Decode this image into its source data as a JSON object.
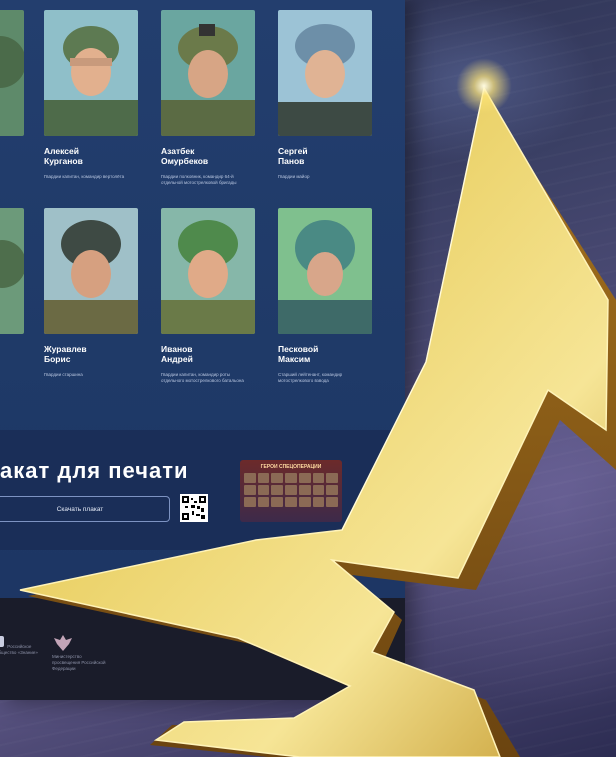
{
  "cards": [
    {
      "name": "Алексей\nКурганов",
      "desc": "Гвардии капитан, командир вертолёта"
    },
    {
      "name": "Азатбек\nОмурбеков",
      "desc": "Гвардии полковник, командир 64-й отдельной мотострелковой бригады"
    },
    {
      "name": "Сергей\nПанов",
      "desc": "Гвардии майор"
    },
    {
      "name": "Журавлев\nБорис",
      "desc": "Гвардии старшина"
    },
    {
      "name": "Иванов\nАндрей",
      "desc": "Гвардии капитан, командир роты отдельного мотострелкового батальона"
    },
    {
      "name": "Песковой\nМаксим",
      "desc": "Старший лейтенант, командир мотострелкового взвода"
    }
  ],
  "print": {
    "title": "акат для печати",
    "download_label": "Скачать плакат",
    "poster_title": "ГЕРОИ СПЕЦОПЕРАЦИИ"
  },
  "footer": {
    "logo1": "Российское общество «Знание»",
    "logo2": "Министерство просвещения Российской Федерации"
  },
  "colors": {
    "panel": "#1f3a68",
    "gold": "#e7c85a",
    "backdrop": "#3a3f64"
  },
  "icons": [
    "qr-code-icon",
    "emblem-icon",
    "znanie-logo-icon"
  ]
}
